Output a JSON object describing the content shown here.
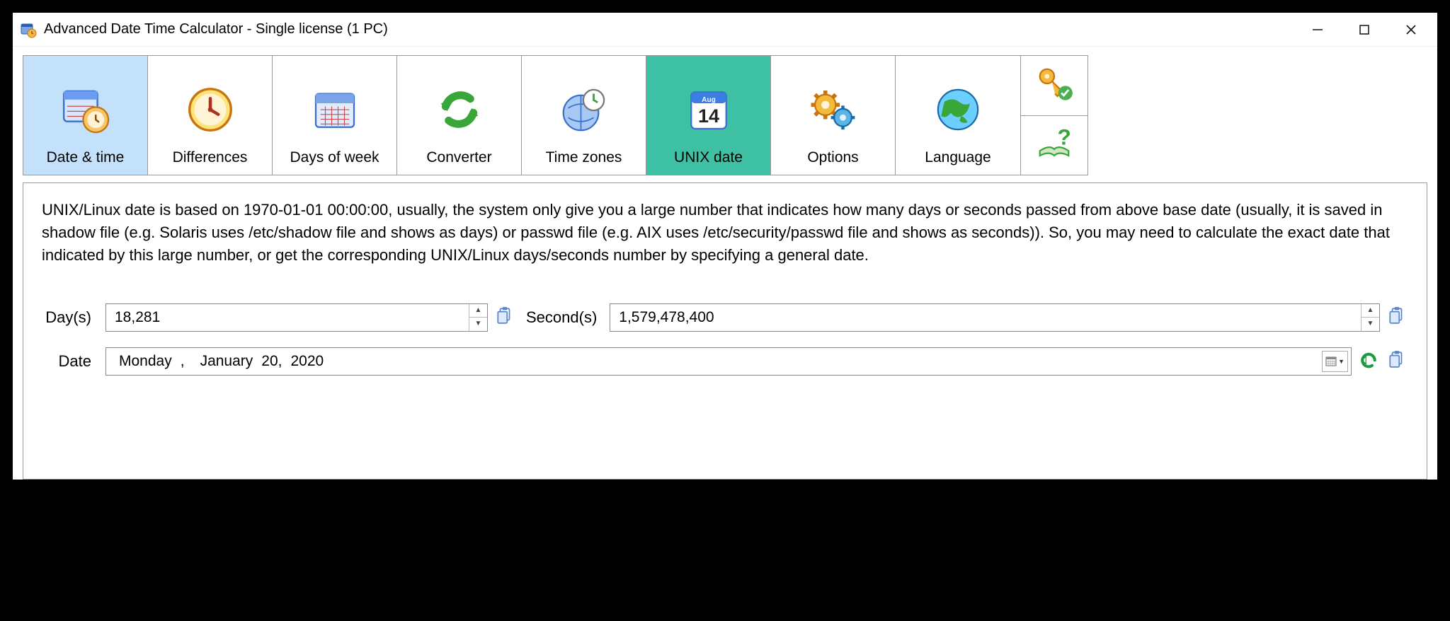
{
  "window": {
    "title": "Advanced Date Time Calculator - Single license (1 PC)"
  },
  "toolbar": {
    "items": [
      {
        "label": "Date & time"
      },
      {
        "label": "Differences"
      },
      {
        "label": "Days of week"
      },
      {
        "label": "Converter"
      },
      {
        "label": "Time zones"
      },
      {
        "label": "UNIX date"
      },
      {
        "label": "Options"
      },
      {
        "label": "Language"
      }
    ],
    "selected_index_blue": 0,
    "selected_index_teal": 5
  },
  "content": {
    "description": "UNIX/Linux date is based on 1970-01-01 00:00:00, usually, the system only give you a large number that indicates how many days or seconds passed from above base date (usually, it is saved in shadow file (e.g. Solaris uses /etc/shadow file and shows as days) or passwd file (e.g. AIX uses /etc/security/passwd file and shows as seconds)). So, you may need to calculate the exact date that indicated by this large number, or get the corresponding UNIX/Linux days/seconds number by specifying a general date.",
    "days_label": "Day(s)",
    "days_value": "18,281",
    "seconds_label": "Second(s)",
    "seconds_value": "1,579,478,400",
    "date_label": "Date",
    "date_weekday": "Monday",
    "date_sep": ",",
    "date_month": "January",
    "date_daynum": "20,",
    "date_year": "2020"
  }
}
